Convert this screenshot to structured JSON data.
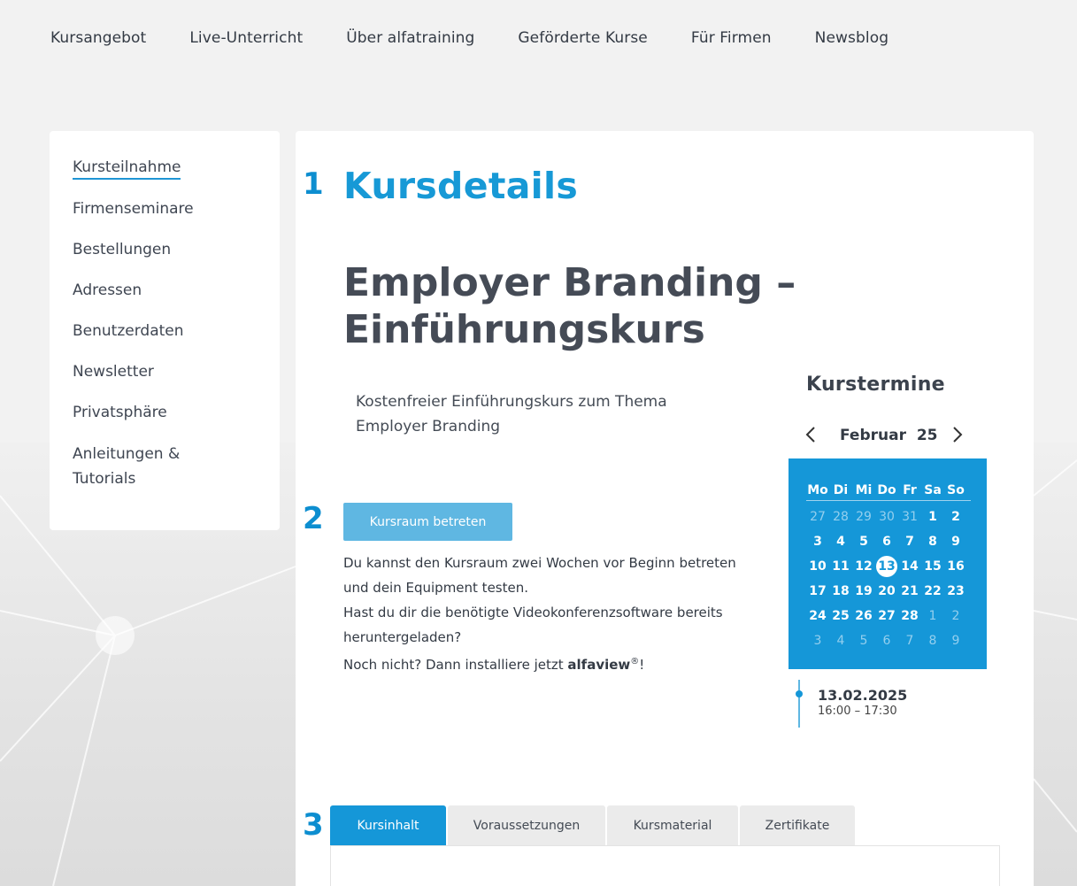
{
  "topnav": {
    "items": [
      "Kursangebot",
      "Live-Unterricht",
      "Über alfatraining",
      "Geförderte Kurse",
      "Für Firmen",
      "Newsblog"
    ]
  },
  "sidebar": {
    "items": [
      "Kursteilnahme",
      "Firmenseminare",
      "Bestellungen",
      "Adressen",
      "Benutzerdaten",
      "Newsletter",
      "Privatsphäre",
      "Anleitungen & Tutorials"
    ]
  },
  "steps": {
    "one": "1",
    "two": "2",
    "three": "3"
  },
  "main": {
    "heading": "Kursdetails",
    "course_title": "Employer Branding – Einführungskurs",
    "description": "Kostenfreier Einführungskurs zum Thema Employer Branding",
    "enter_button": "Kursraum betreten",
    "info_line1": "Du kannst den Kursraum zwei Wochen vor Beginn betreten",
    "info_line2": "und dein Equipment testen.",
    "info_line3": "Hast du dir die benötigte Videokonferenzsoftware bereits",
    "info_line4": "heruntergeladen?",
    "info_line5_prefix": "Noch nicht? Dann installiere jetzt ",
    "info_brand": "alfaview",
    "info_reg": "®",
    "info_suffix": "!"
  },
  "calendar": {
    "heading": "Kurstermine",
    "month_label": "Februar",
    "year_label": "25",
    "prev_icon": "chevron-left-icon",
    "next_icon": "chevron-right-icon",
    "weekdays": [
      "Mo",
      "Di",
      "Mi",
      "Do",
      "Fr",
      "Sa",
      "So"
    ],
    "weeks": [
      [
        {
          "d": "27",
          "out": true
        },
        {
          "d": "28",
          "out": true
        },
        {
          "d": "29",
          "out": true
        },
        {
          "d": "30",
          "out": true
        },
        {
          "d": "31",
          "out": true
        },
        {
          "d": "1",
          "out": false
        },
        {
          "d": "2",
          "out": false
        }
      ],
      [
        {
          "d": "3",
          "out": false
        },
        {
          "d": "4",
          "out": false
        },
        {
          "d": "5",
          "out": false
        },
        {
          "d": "6",
          "out": false
        },
        {
          "d": "7",
          "out": false
        },
        {
          "d": "8",
          "out": false
        },
        {
          "d": "9",
          "out": false
        }
      ],
      [
        {
          "d": "10",
          "out": false
        },
        {
          "d": "11",
          "out": false
        },
        {
          "d": "12",
          "out": false
        },
        {
          "d": "13",
          "out": false,
          "sel": true
        },
        {
          "d": "14",
          "out": false
        },
        {
          "d": "15",
          "out": false
        },
        {
          "d": "16",
          "out": false
        }
      ],
      [
        {
          "d": "17",
          "out": false
        },
        {
          "d": "18",
          "out": false
        },
        {
          "d": "19",
          "out": false
        },
        {
          "d": "20",
          "out": false
        },
        {
          "d": "21",
          "out": false
        },
        {
          "d": "22",
          "out": false
        },
        {
          "d": "23",
          "out": false
        }
      ],
      [
        {
          "d": "24",
          "out": false
        },
        {
          "d": "25",
          "out": false
        },
        {
          "d": "26",
          "out": false
        },
        {
          "d": "27",
          "out": false
        },
        {
          "d": "28",
          "out": false
        },
        {
          "d": "1",
          "out": true
        },
        {
          "d": "2",
          "out": true
        }
      ],
      [
        {
          "d": "3",
          "out": true
        },
        {
          "d": "4",
          "out": true
        },
        {
          "d": "5",
          "out": true
        },
        {
          "d": "6",
          "out": true
        },
        {
          "d": "7",
          "out": true
        },
        {
          "d": "8",
          "out": true
        },
        {
          "d": "9",
          "out": true
        }
      ]
    ],
    "event_date": "13.02.2025",
    "event_time": "16:00 – 17:30"
  },
  "tabs": [
    {
      "label": "Kursinhalt",
      "active": true
    },
    {
      "label": "Voraussetzungen",
      "active": false
    },
    {
      "label": "Kursmaterial",
      "active": false
    },
    {
      "label": "Zertifikate",
      "active": false
    }
  ],
  "colors": {
    "accent": "#1597d8",
    "button": "#5fb7e2",
    "text": "#3d4451"
  }
}
